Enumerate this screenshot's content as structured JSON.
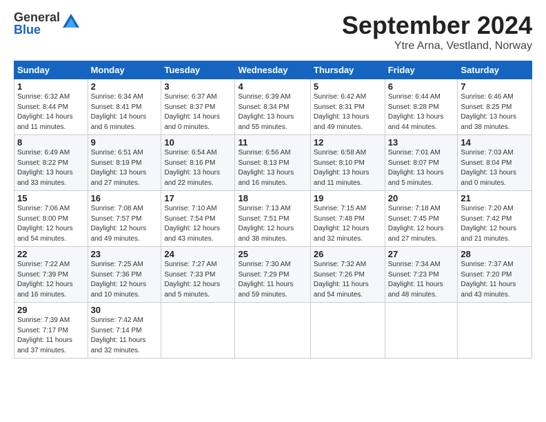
{
  "header": {
    "logo_general": "General",
    "logo_blue": "Blue",
    "title": "September 2024",
    "location": "Ytre Arna, Vestland, Norway"
  },
  "calendar": {
    "days_of_week": [
      "Sunday",
      "Monday",
      "Tuesday",
      "Wednesday",
      "Thursday",
      "Friday",
      "Saturday"
    ],
    "weeks": [
      [
        {
          "day": "1",
          "info": "Sunrise: 6:32 AM\nSunset: 8:44 PM\nDaylight: 14 hours\nand 11 minutes."
        },
        {
          "day": "2",
          "info": "Sunrise: 6:34 AM\nSunset: 8:41 PM\nDaylight: 14 hours\nand 6 minutes."
        },
        {
          "day": "3",
          "info": "Sunrise: 6:37 AM\nSunset: 8:37 PM\nDaylight: 14 hours\nand 0 minutes."
        },
        {
          "day": "4",
          "info": "Sunrise: 6:39 AM\nSunset: 8:34 PM\nDaylight: 13 hours\nand 55 minutes."
        },
        {
          "day": "5",
          "info": "Sunrise: 6:42 AM\nSunset: 8:31 PM\nDaylight: 13 hours\nand 49 minutes."
        },
        {
          "day": "6",
          "info": "Sunrise: 6:44 AM\nSunset: 8:28 PM\nDaylight: 13 hours\nand 44 minutes."
        },
        {
          "day": "7",
          "info": "Sunrise: 6:46 AM\nSunset: 8:25 PM\nDaylight: 13 hours\nand 38 minutes."
        }
      ],
      [
        {
          "day": "8",
          "info": "Sunrise: 6:49 AM\nSunset: 8:22 PM\nDaylight: 13 hours\nand 33 minutes."
        },
        {
          "day": "9",
          "info": "Sunrise: 6:51 AM\nSunset: 8:19 PM\nDaylight: 13 hours\nand 27 minutes."
        },
        {
          "day": "10",
          "info": "Sunrise: 6:54 AM\nSunset: 8:16 PM\nDaylight: 13 hours\nand 22 minutes."
        },
        {
          "day": "11",
          "info": "Sunrise: 6:56 AM\nSunset: 8:13 PM\nDaylight: 13 hours\nand 16 minutes."
        },
        {
          "day": "12",
          "info": "Sunrise: 6:58 AM\nSunset: 8:10 PM\nDaylight: 13 hours\nand 11 minutes."
        },
        {
          "day": "13",
          "info": "Sunrise: 7:01 AM\nSunset: 8:07 PM\nDaylight: 13 hours\nand 5 minutes."
        },
        {
          "day": "14",
          "info": "Sunrise: 7:03 AM\nSunset: 8:04 PM\nDaylight: 13 hours\nand 0 minutes."
        }
      ],
      [
        {
          "day": "15",
          "info": "Sunrise: 7:06 AM\nSunset: 8:00 PM\nDaylight: 12 hours\nand 54 minutes."
        },
        {
          "day": "16",
          "info": "Sunrise: 7:08 AM\nSunset: 7:57 PM\nDaylight: 12 hours\nand 49 minutes."
        },
        {
          "day": "17",
          "info": "Sunrise: 7:10 AM\nSunset: 7:54 PM\nDaylight: 12 hours\nand 43 minutes."
        },
        {
          "day": "18",
          "info": "Sunrise: 7:13 AM\nSunset: 7:51 PM\nDaylight: 12 hours\nand 38 minutes."
        },
        {
          "day": "19",
          "info": "Sunrise: 7:15 AM\nSunset: 7:48 PM\nDaylight: 12 hours\nand 32 minutes."
        },
        {
          "day": "20",
          "info": "Sunrise: 7:18 AM\nSunset: 7:45 PM\nDaylight: 12 hours\nand 27 minutes."
        },
        {
          "day": "21",
          "info": "Sunrise: 7:20 AM\nSunset: 7:42 PM\nDaylight: 12 hours\nand 21 minutes."
        }
      ],
      [
        {
          "day": "22",
          "info": "Sunrise: 7:22 AM\nSunset: 7:39 PM\nDaylight: 12 hours\nand 16 minutes."
        },
        {
          "day": "23",
          "info": "Sunrise: 7:25 AM\nSunset: 7:36 PM\nDaylight: 12 hours\nand 10 minutes."
        },
        {
          "day": "24",
          "info": "Sunrise: 7:27 AM\nSunset: 7:33 PM\nDaylight: 12 hours\nand 5 minutes."
        },
        {
          "day": "25",
          "info": "Sunrise: 7:30 AM\nSunset: 7:29 PM\nDaylight: 11 hours\nand 59 minutes."
        },
        {
          "day": "26",
          "info": "Sunrise: 7:32 AM\nSunset: 7:26 PM\nDaylight: 11 hours\nand 54 minutes."
        },
        {
          "day": "27",
          "info": "Sunrise: 7:34 AM\nSunset: 7:23 PM\nDaylight: 11 hours\nand 48 minutes."
        },
        {
          "day": "28",
          "info": "Sunrise: 7:37 AM\nSunset: 7:20 PM\nDaylight: 11 hours\nand 43 minutes."
        }
      ],
      [
        {
          "day": "29",
          "info": "Sunrise: 7:39 AM\nSunset: 7:17 PM\nDaylight: 11 hours\nand 37 minutes."
        },
        {
          "day": "30",
          "info": "Sunrise: 7:42 AM\nSunset: 7:14 PM\nDaylight: 11 hours\nand 32 minutes."
        },
        {
          "day": "",
          "info": ""
        },
        {
          "day": "",
          "info": ""
        },
        {
          "day": "",
          "info": ""
        },
        {
          "day": "",
          "info": ""
        },
        {
          "day": "",
          "info": ""
        }
      ]
    ]
  }
}
